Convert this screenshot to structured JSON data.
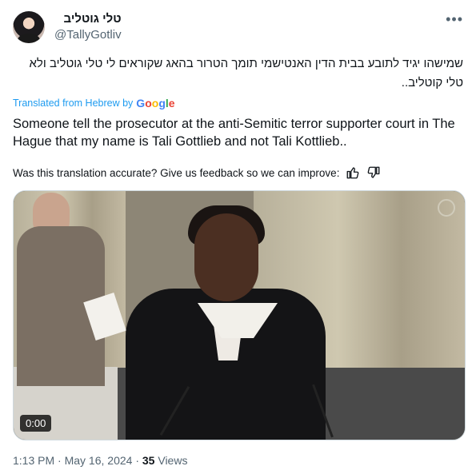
{
  "author": {
    "display_name": "טלי גוטליב",
    "handle": "@TallyGotliv"
  },
  "more_icon": "more-horizontal-icon",
  "tweet": {
    "original_text": "שמישהו יגיד לתובע בבית הדין האנטישמי תומך הטרור בהאג שקוראים לי טלי גוטליב ולא טלי קוטליב..",
    "translated_from": "Translated from Hebrew by",
    "translation_provider": "Google",
    "translation_text": "Someone tell the prosecutor at the anti-Semitic terror supporter court in The Hague that my name is Tali Gottlieb and not Tali Kottlieb..",
    "feedback_prompt": "Was this translation accurate? Give us feedback so we can improve:"
  },
  "media": {
    "duration": "0:00"
  },
  "meta": {
    "time": "1:13 PM",
    "separator": "·",
    "date": "May 16, 2024",
    "views_count": "35",
    "views_label": "Views"
  },
  "colors": {
    "link": "#1d9bf0",
    "secondary_text": "#536471"
  }
}
